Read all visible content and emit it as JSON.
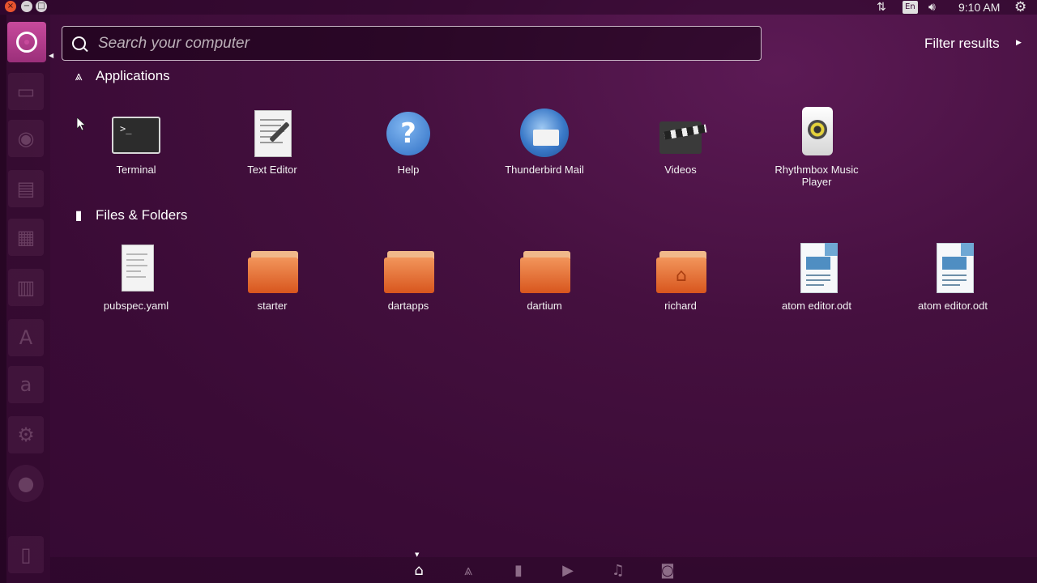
{
  "top_panel": {
    "clock": "9:10 AM",
    "keyboard_layout": "En",
    "icons": [
      "network-icon",
      "sound-icon",
      "system-gear-icon"
    ]
  },
  "search": {
    "placeholder": "Search your computer",
    "value": "",
    "filter_label": "Filter results"
  },
  "applications": {
    "title": "Applications",
    "items": [
      {
        "label": "Terminal",
        "icon": "terminal-icon"
      },
      {
        "label": "Text Editor",
        "icon": "text-editor-icon"
      },
      {
        "label": "Help",
        "icon": "help-icon"
      },
      {
        "label": "Thunderbird Mail",
        "icon": "thunderbird-icon"
      },
      {
        "label": "Videos",
        "icon": "videos-icon"
      },
      {
        "label": "Rhythmbox Music Player",
        "icon": "rhythmbox-icon"
      }
    ]
  },
  "files": {
    "title": "Files & Folders",
    "items": [
      {
        "label": "pubspec.yaml",
        "icon": "text-file-icon"
      },
      {
        "label": "starter",
        "icon": "folder-icon"
      },
      {
        "label": "dartapps",
        "icon": "folder-icon"
      },
      {
        "label": "dartium",
        "icon": "folder-icon"
      },
      {
        "label": "richard",
        "icon": "home-folder-icon"
      },
      {
        "label": "atom editor.odt",
        "icon": "odt-document-icon"
      },
      {
        "label": "atom editor.odt",
        "icon": "odt-document-icon"
      }
    ]
  },
  "launcher": {
    "items": [
      "files-icon",
      "firefox-icon",
      "writer-icon",
      "calc-icon",
      "impress-icon",
      "software-center-icon",
      "amazon-icon",
      "settings-icon",
      "ubuntu-one-icon",
      "trash-icon"
    ]
  },
  "lenses": [
    "home-lens-icon",
    "applications-lens-icon",
    "files-lens-icon",
    "video-lens-icon",
    "music-lens-icon",
    "photo-lens-icon"
  ],
  "colors": {
    "background": "#3a0b36",
    "dash_button": "#c84a9c",
    "folder": "#e8743a"
  }
}
